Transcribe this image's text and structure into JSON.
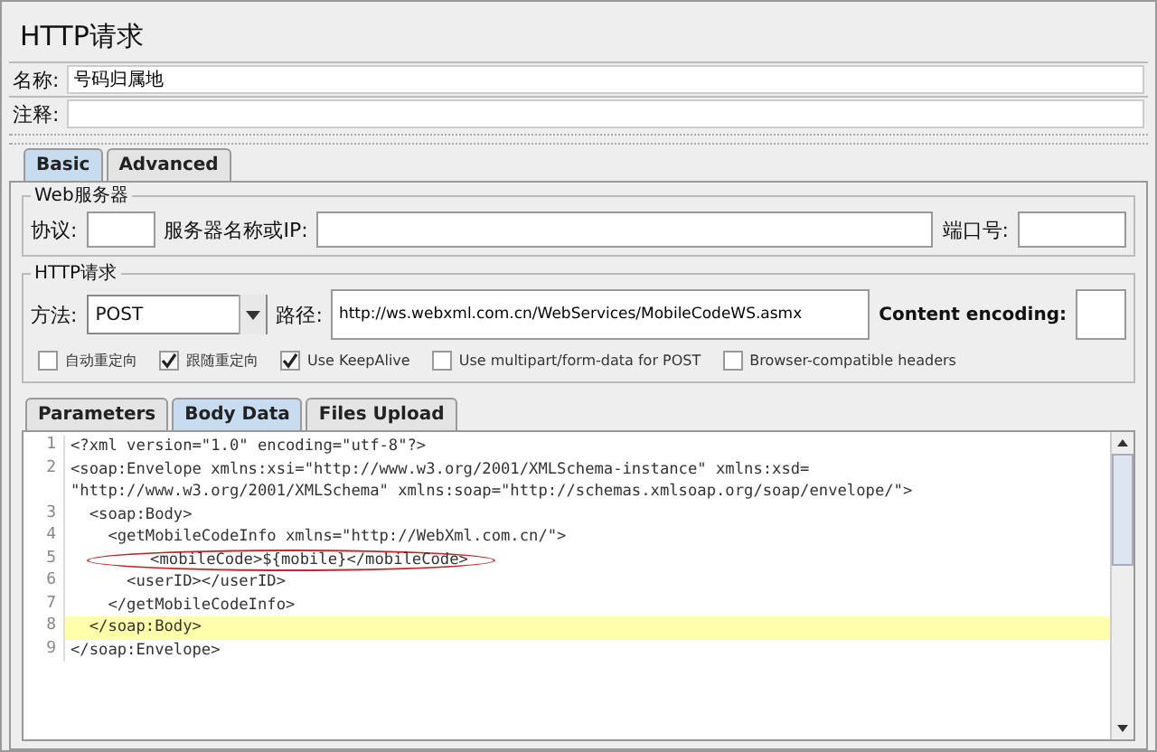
{
  "panel": {
    "title": "HTTP请求"
  },
  "fields": [
    {
      "label": "名称:",
      "value": "号码归属地"
    },
    {
      "label": "注释:"
    }
  ],
  "tabs": [
    {
      "label": "Basic",
      "selected": true
    },
    {
      "label": "Advanced",
      "selected": false
    }
  ],
  "web_server": {
    "title": "Web服务器",
    "protocol_label": "协议:",
    "server_label": "服务器名称或IP:",
    "port_label": "端口号:"
  },
  "http_request": {
    "title": "HTTP请求",
    "method_label": "方法:",
    "method": "POST",
    "path_label": "路径:",
    "path": "http://ws.webxml.com.cn/WebServices/MobileCodeWS.asmx",
    "encoding_label": "Content encoding:",
    "options": [
      {
        "label": "自动重定向",
        "checked": false
      },
      {
        "label": "跟随重定向",
        "checked": true
      },
      {
        "label": "Use KeepAlive",
        "checked": true
      },
      {
        "label": "Use multipart/form-data for POST",
        "checked": false
      },
      {
        "label": "Browser-compatible headers",
        "checked": false
      }
    ]
  },
  "sub_tabs": [
    {
      "label": "Parameters",
      "selected": false
    },
    {
      "label": "Body Data",
      "selected": true
    },
    {
      "label": "Files Upload",
      "selected": false
    }
  ],
  "editor": {
    "lines": [
      {
        "number": "1",
        "segments": [
          "<?xml version=\"1.0\" encoding=\"utf-8\"?>"
        ],
        "current": false,
        "circled": false
      },
      {
        "number": "2",
        "segments": [
          "<soap:Envelope xmlns:xsi=\"http://www.w3.org/2001/XMLSchema-instance\" xmlns:xsd=",
          "\"http://www.w3.org/2001/XMLSchema\" xmlns:soap=\"http://schemas.xmlsoap.org/soap/envelope/\">"
        ],
        "current": false,
        "circled": false
      },
      {
        "number": "3",
        "segments": [
          "  <soap:Body>"
        ],
        "current": false,
        "circled": false
      },
      {
        "number": "4",
        "segments": [
          "    <getMobileCodeInfo xmlns=\"http://WebXml.com.cn/\">"
        ],
        "current": false,
        "circled": false
      },
      {
        "number": "5",
        "segments": [
          "      <mobileCode>${mobile}</mobileCode>"
        ],
        "current": false,
        "circled": true
      },
      {
        "number": "6",
        "segments": [
          "      <userID></userID>"
        ],
        "current": false,
        "circled": false
      },
      {
        "number": "7",
        "segments": [
          "    </getMobileCodeInfo>"
        ],
        "current": false,
        "circled": false
      },
      {
        "number": "8",
        "segments": [
          "  </soap:Body>"
        ],
        "current": true,
        "circled": false
      },
      {
        "number": "9",
        "segments": [
          "</soap:Envelope>"
        ],
        "current": false,
        "circled": false
      }
    ]
  }
}
